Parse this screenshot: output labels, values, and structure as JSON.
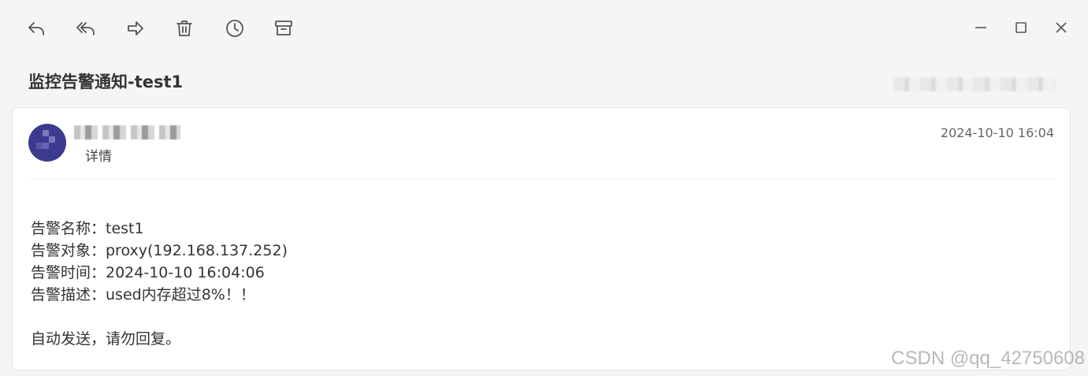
{
  "subject": "监控告警通知-test1",
  "message": {
    "details_label": "详情",
    "date": "2024-10-10 16:04",
    "body_lines": [
      "告警名称：test1",
      "告警对象：proxy(192.168.137.252)",
      "告警时间：2024-10-10 16:04:06",
      "告警描述：used内存超过8%！！"
    ],
    "footer_line": "自动发送，请勿回复。"
  },
  "watermark": "CSDN @qq_42750608",
  "toolbar": {
    "icons": [
      "reply-icon",
      "reply-all-icon",
      "forward-icon",
      "delete-icon",
      "snooze-icon",
      "archive-icon"
    ]
  },
  "window": {
    "controls": [
      "minimize-icon",
      "maximize-icon",
      "close-icon"
    ]
  },
  "colors": {
    "avatar_bg": "#3c3a8f",
    "background": "#f5f5f5"
  }
}
